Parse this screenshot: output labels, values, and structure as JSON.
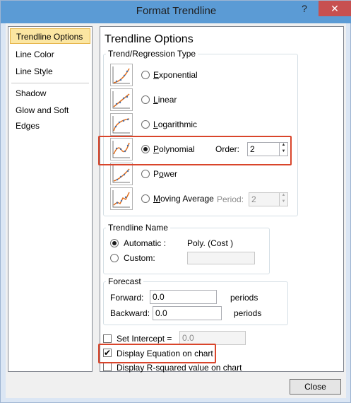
{
  "window": {
    "title": "Format Trendline",
    "help": "?",
    "close": "✕"
  },
  "nav": {
    "items": [
      {
        "label": "Trendline Options",
        "active": true
      },
      {
        "label": "Line Color"
      },
      {
        "label": "Line Style"
      },
      {
        "label": "Shadow"
      },
      {
        "label": "Glow and Soft Edges"
      }
    ]
  },
  "panel": {
    "title": "Trendline Options",
    "trend_group_label": "Trend/Regression Type",
    "types": [
      {
        "label": "Exponential",
        "ul": "E",
        "rest": "xponential",
        "checked": false
      },
      {
        "label": "Linear",
        "ul": "L",
        "rest": "inear",
        "checked": false
      },
      {
        "label": "Logarithmic",
        "ul": "L",
        "rest": "ogarithmic",
        "checked": false
      },
      {
        "label": "Polynomial",
        "ul": "P",
        "rest": "olynomial",
        "checked": true
      },
      {
        "label": "Power",
        "ul": "o",
        "pre": "P",
        "rest": "wer",
        "checked": false
      },
      {
        "label": "Moving Average",
        "ul": "M",
        "rest": "oving Average",
        "checked": false
      }
    ],
    "order_label": "Order:",
    "order_value": "2",
    "period_label": "Period:",
    "period_value": "2",
    "name_group_label": "Trendline Name",
    "automatic_label": "Automatic :",
    "automatic_value": "Poly. (Cost )",
    "custom_label": "Custom:",
    "forecast_group_label": "Forecast",
    "forward_label": "Forward:",
    "forward_value": "0.0",
    "forward_unit": "periods",
    "backward_label": "Backward:",
    "backward_value": "0.0",
    "backward_unit": "periods",
    "set_intercept_label": "Set Intercept =",
    "set_intercept_value": "0.0",
    "display_equation_label": "Display Equation on chart",
    "display_equation_checked": true,
    "display_rsquared_label": "Display R-squared value on chart",
    "display_rsquared_checked": false
  },
  "footer": {
    "close_label": "Close"
  },
  "colors": {
    "highlight": "#d9452b",
    "titlebar": "#5b9bd5",
    "close_red": "#c75050"
  }
}
